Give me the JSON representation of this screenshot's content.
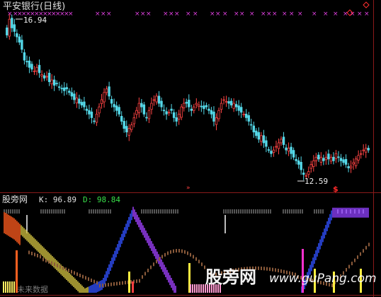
{
  "price_panel": {
    "title": "平安银行(日线)",
    "high_label": "16.94",
    "low_label": "12.59",
    "signal_glyph": "$",
    "marker_glyph": "»",
    "cross_glyph": "×"
  },
  "indicator_panel": {
    "name": "股旁网",
    "k_label": "K: 96.89",
    "d_label": "D: 98.84",
    "future_text": "未来数据"
  },
  "watermark": {
    "cn": "股旁网",
    "url": "www.guPang.com"
  },
  "colors": {
    "background": "#000000",
    "up_candle": "#ff4444",
    "down_candle": "#54d8e8",
    "panel_border": "#8a1a1a",
    "cross_marks": "#e040e0",
    "k_line": "#ff4fd0",
    "d_line": "#4040ff",
    "gray_band": "#aaaaaa"
  },
  "chart_data": [
    {
      "type": "candlestick",
      "title": "平安银行(日线)",
      "period": "daily",
      "ylim": [
        12.2,
        17.2
      ],
      "close": [
        16.5,
        16.94,
        16.7,
        16.6,
        16.45,
        16.3,
        16.1,
        15.8,
        15.75,
        15.6,
        15.55,
        15.5,
        15.6,
        15.45,
        15.4,
        15.3,
        15.35,
        15.2,
        15.25,
        15.1,
        15.15,
        15.05,
        15.0,
        14.95,
        15.0,
        14.9,
        14.8,
        14.7,
        14.75,
        14.6,
        14.55,
        14.5,
        14.4,
        14.3,
        14.2,
        14.1,
        14.3,
        14.5,
        14.7,
        14.9,
        15.0,
        14.8,
        14.6,
        14.5,
        14.4,
        14.3,
        14.1,
        13.9,
        13.8,
        13.9,
        14.0,
        14.2,
        14.4,
        14.6,
        14.5,
        14.3,
        14.2,
        14.4,
        14.6,
        14.7,
        14.8,
        14.6,
        14.5,
        14.4,
        14.3,
        14.35,
        14.4,
        14.2,
        14.1,
        14.3,
        14.5,
        14.6,
        14.6,
        14.5,
        14.4,
        14.5,
        14.6,
        14.55,
        14.5,
        14.45,
        14.5,
        14.4,
        14.3,
        14.1,
        14.2,
        14.4,
        14.6,
        14.7,
        14.65,
        14.6,
        14.55,
        14.6,
        14.5,
        14.4,
        14.35,
        14.3,
        14.2,
        14.1,
        14.0,
        13.8,
        13.7,
        13.6,
        13.7,
        13.5,
        13.4,
        13.3,
        13.2,
        13.3,
        13.4,
        13.5,
        13.6,
        13.45,
        13.3,
        13.35,
        13.2,
        13.1,
        13.0,
        12.9,
        12.75,
        12.62,
        12.59,
        12.7,
        12.9,
        13.0,
        13.1,
        13.05,
        13.1,
        13.0,
        13.1,
        13.05,
        13.1,
        13.0,
        13.2,
        13.1,
        13.0,
        12.95,
        12.9,
        12.8,
        12.85,
        12.95,
        13.05,
        13.15,
        13.2,
        13.3,
        13.35,
        13.3
      ],
      "high_marker": 16.94,
      "low_marker": 12.59
    },
    {
      "type": "line",
      "title": "股旁网",
      "series": [
        {
          "name": "K",
          "last": 96.89
        },
        {
          "name": "D",
          "last": 98.84
        }
      ],
      "ylim": [
        0,
        100
      ]
    }
  ]
}
